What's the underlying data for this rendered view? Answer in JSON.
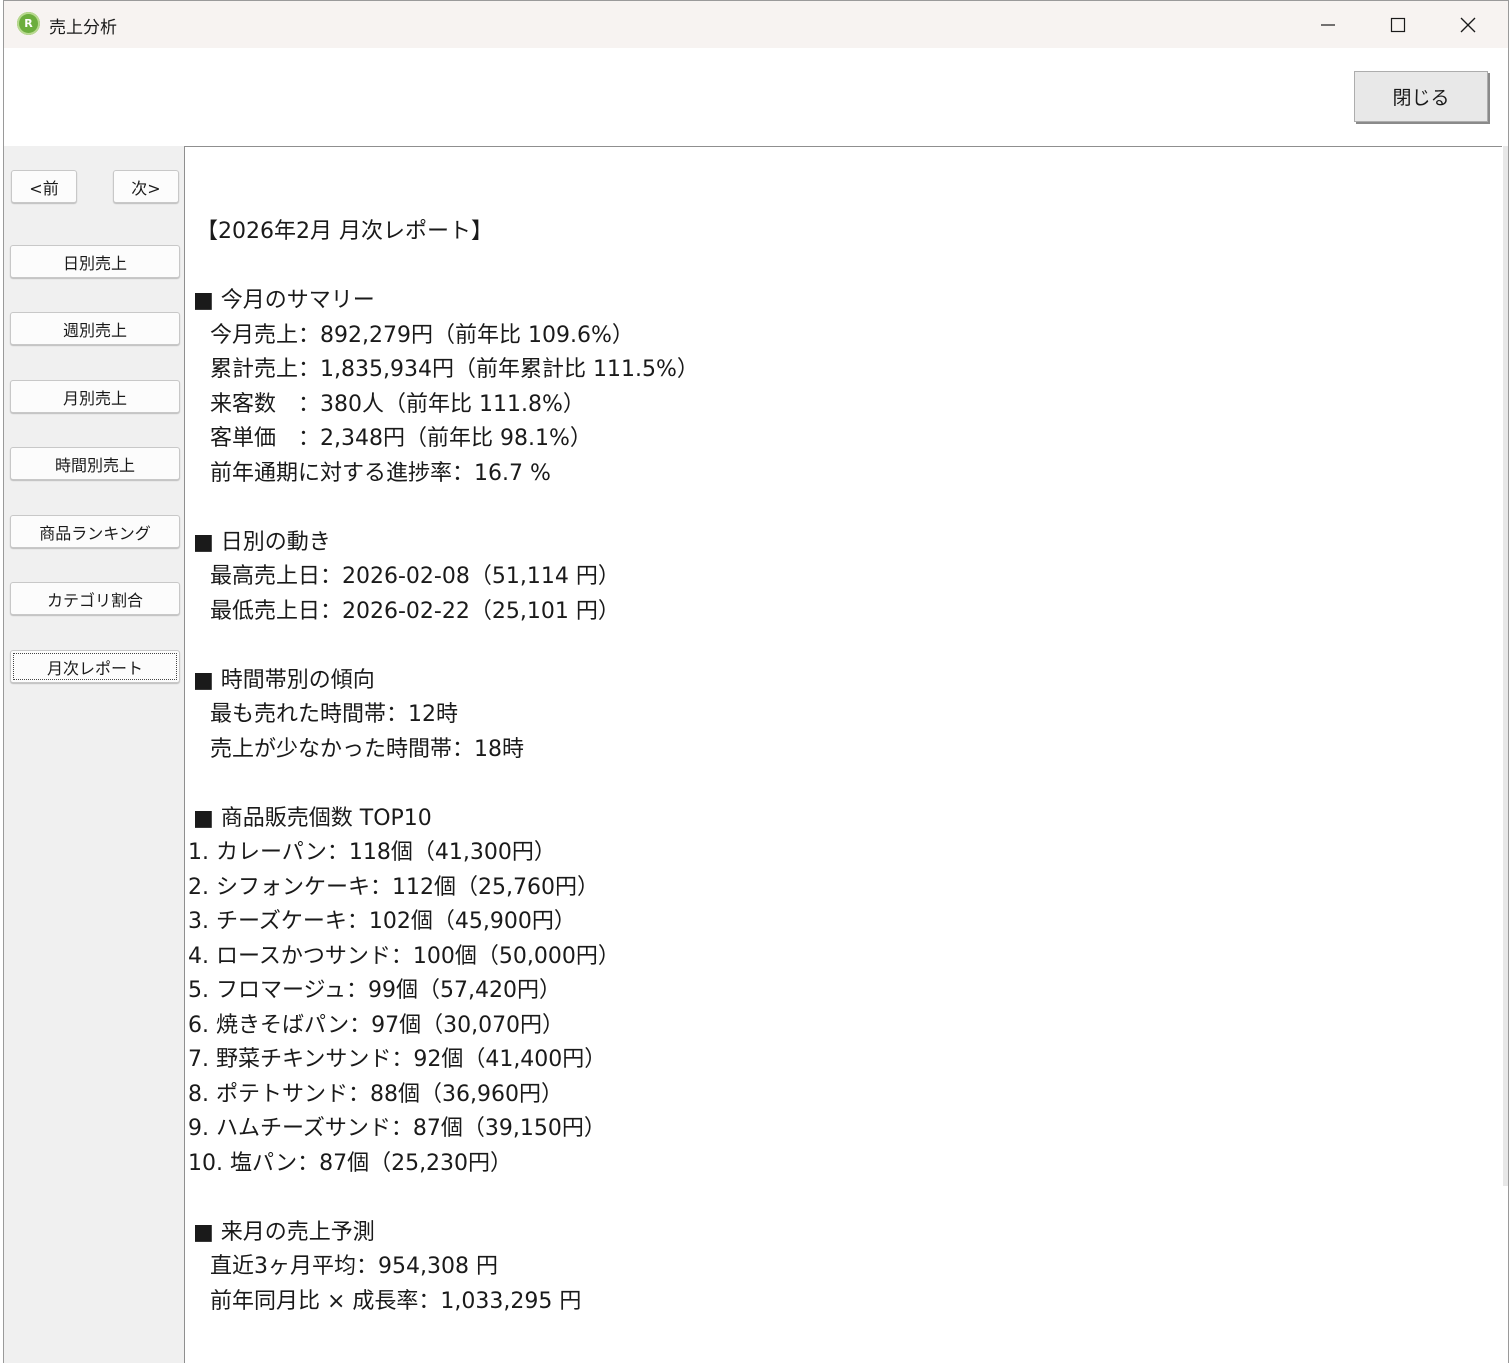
{
  "window": {
    "title": "売上分析",
    "icon": "bread-app-icon",
    "icon_glyph": "R"
  },
  "topbar": {
    "close_label": "閉じる"
  },
  "sidebar": {
    "prev_label": "<前",
    "next_label": "次>",
    "items": [
      {
        "label": "日別売上"
      },
      {
        "label": "週別売上"
      },
      {
        "label": "月別売上"
      },
      {
        "label": "時間別売上"
      },
      {
        "label": "商品ランキング"
      },
      {
        "label": "カテゴリ割合"
      },
      {
        "label": "月次レポート",
        "active": true
      }
    ]
  },
  "report": {
    "title": "【2026年2月 月次レポート】",
    "summary": {
      "heading": "■ 今月のサマリー",
      "lines": [
        "今月売上：892,279円（前年比 109.6%）",
        "累計売上：1,835,934円（前年累計比 111.5%）",
        "来客数　：380人（前年比 111.8%）",
        "客単価　：2,348円（前年比 98.1%）",
        "前年通期に対する進捗率：16.7 %"
      ]
    },
    "daily": {
      "heading": "■ 日別の動き",
      "lines": [
        "最高売上日：2026-02-08（51,114 円）",
        "最低売上日：2026-02-22（25,101 円）"
      ]
    },
    "hourly": {
      "heading": "■ 時間帯別の傾向",
      "lines": [
        "最も売れた時間帯：12時",
        "売上が少なかった時間帯：18時"
      ]
    },
    "top10": {
      "heading": "■ 商品販売個数 TOP10",
      "lines": [
        "1. カレーパン：118個（41,300円）",
        "2. シフォンケーキ：112個（25,760円）",
        "3. チーズケーキ：102個（45,900円）",
        "4. ロースかつサンド：100個（50,000円）",
        "5. フロマージュ：99個（57,420円）",
        "6. 焼きそばパン：97個（30,070円）",
        "7. 野菜チキンサンド：92個（41,400円）",
        "8. ポテトサンド：88個（36,960円）",
        "9. ハムチーズサンド：87個（39,150円）",
        "10. 塩パン：87個（25,230円）"
      ]
    },
    "forecast": {
      "heading": "■ 来月の売上予測",
      "lines": [
        "直近3ヶ月平均：954,308 円",
        "前年同月比 × 成長率：1,033,295 円"
      ]
    }
  }
}
